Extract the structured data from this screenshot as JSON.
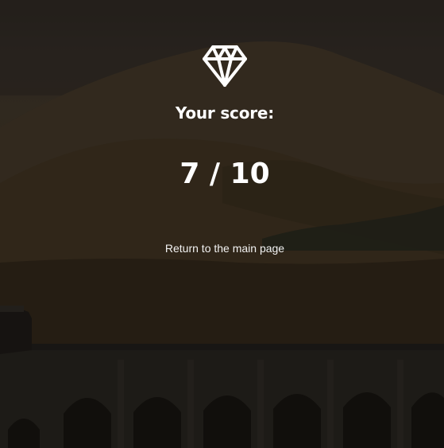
{
  "score": {
    "label": "Your score:",
    "value": "7 / 10"
  },
  "navigation": {
    "return_label": "Return to the main page"
  },
  "icons": {
    "badge": "diamond-icon"
  },
  "colors": {
    "text": "#ffffff",
    "background": "#2f271d"
  }
}
